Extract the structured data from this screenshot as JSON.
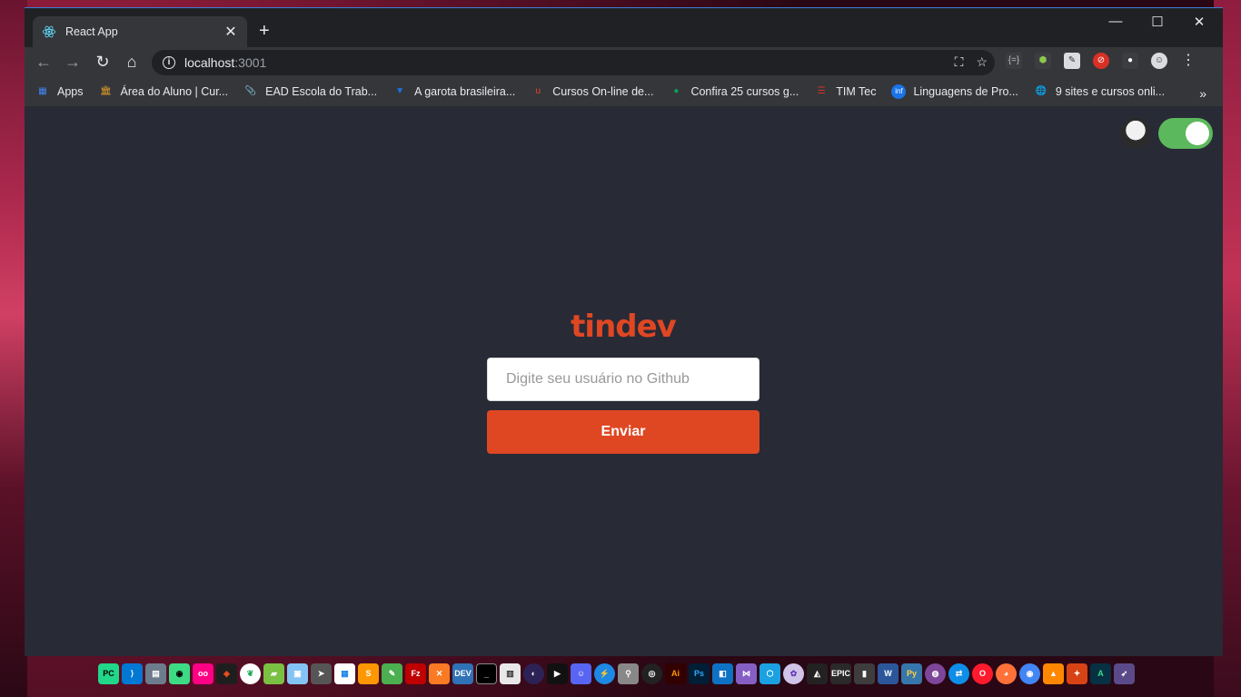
{
  "browser": {
    "tab_title": "React App",
    "tab_close": "✕",
    "new_tab": "+",
    "window_controls": {
      "minimize": "—",
      "maximize": "☐",
      "close": "✕"
    },
    "nav": {
      "back": "←",
      "forward": "→",
      "reload": "↻",
      "home": "⌂"
    },
    "url_host": "localhost",
    "url_port": ":3001",
    "omnibox_icons": {
      "translate": "⛶",
      "bookmark": "☆"
    },
    "menu": "⋮"
  },
  "bookmarks": [
    {
      "label": "Apps",
      "color": "#4285f4",
      "icon": "▦"
    },
    {
      "label": "Área do Aluno | Cur...",
      "color": "#e8a427",
      "icon": "🏛"
    },
    {
      "label": "EAD Escola do Trab...",
      "color": "#8ab4f8",
      "icon": "📎"
    },
    {
      "label": "A garota brasileira...",
      "color": "#1a73e8",
      "icon": "▼"
    },
    {
      "label": "Cursos On-line de...",
      "color": "#ea4335",
      "icon": "u"
    },
    {
      "label": "Confira 25 cursos g...",
      "color": "#0f9d58",
      "icon": "●"
    },
    {
      "label": "TIM Tec",
      "color": "#d93025",
      "icon": "☰"
    },
    {
      "label": "Linguagens de Pro...",
      "color": "#1a73e8",
      "icon": "inf"
    },
    {
      "label": "9 sites e cursos onli...",
      "color": "#e8eaed",
      "icon": "🌐"
    }
  ],
  "bookmarks_more": "»",
  "page": {
    "logo": "tindev",
    "input_placeholder": "Digite seu usuário no Github",
    "submit_label": "Enviar",
    "toggle_on": true
  },
  "taskbar_icons": [
    "pycharm-icon",
    "vscode-icon",
    "database-icon",
    "android-icon",
    "flickr-icon",
    "figma-icon",
    "mongodb-icon",
    "bluestacks-icon",
    "virtualbox-icon",
    "cursor-icon",
    "app-icon",
    "sublime-icon",
    "notepad-icon",
    "filezilla-icon",
    "xampp-icon",
    "devc-icon",
    "terminal-icon",
    "app2-icon",
    "eclipse-icon",
    "media-icon",
    "discord-icon",
    "app3-icon",
    "usb-icon",
    "obs-icon",
    "illustrator-icon",
    "photoshop-icon",
    "app4-icon",
    "visualstudio-icon",
    "app5-icon",
    "app6-icon",
    "unity-icon",
    "epic-games-icon",
    "app7-icon",
    "word-icon",
    "python-icon",
    "tor-icon",
    "teamviewer-icon",
    "opera-icon",
    "firefox-icon",
    "chrome-icon",
    "vlc-icon",
    "app8-icon",
    "android-studio-icon",
    "arrow-icon"
  ]
}
